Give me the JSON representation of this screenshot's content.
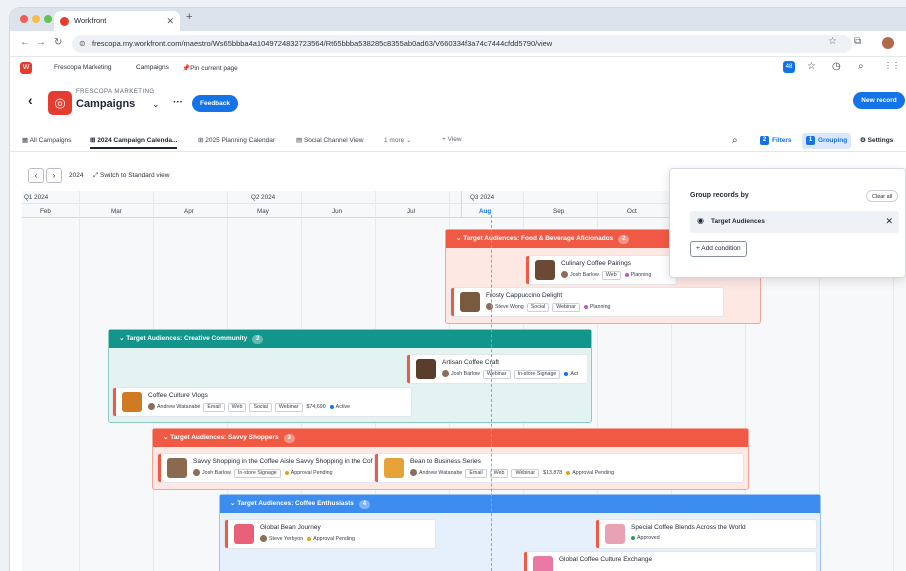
{
  "browser": {
    "tab_title": "Workfront",
    "tab_close": "✕",
    "new_tab": "+",
    "url": "frescopa.my.workfront.com/maestro/Ws65bbba4a1049724832723564/Rt65bbba538285c8355ab0ad63/V660334f3a74c7444cfdd5790/view",
    "nav": {
      "back": "←",
      "fwd": "→",
      "reload": "↻"
    },
    "icons": {
      "star": "☆",
      "ext": "⧉"
    }
  },
  "topnav": {
    "logo": "W",
    "workspace": "Frescopa Marketing",
    "campaigns": "Campaigns",
    "pin_label": "Pin current page",
    "badge": "48",
    "icons": {
      "star": "☆",
      "clock": "◷",
      "search": "⌕",
      "grid": "⋮⋮"
    }
  },
  "page": {
    "back": "‹",
    "org": "FRESCOPA MARKETING",
    "title": "Campaigns",
    "caret": "⌄",
    "more": "···",
    "feedback": "Feedback",
    "new_record": "New record",
    "icon": "◎"
  },
  "views": [
    {
      "label": "All Campaigns",
      "icon": "▦"
    },
    {
      "label": "2024 Campaign Calenda...",
      "icon": "⊞",
      "active": true
    },
    {
      "label": "2025 Planning Calendar",
      "icon": "⊞"
    },
    {
      "label": "Social Channel View",
      "icon": "▤"
    },
    {
      "label": "1 more ⌄"
    },
    {
      "label": "View",
      "icon": "+"
    }
  ],
  "toolbar": {
    "search": "⌕",
    "filters_label": "Filters",
    "filters_count": "2",
    "grouping_label": "Grouping",
    "grouping_count": "1",
    "settings_label": "Settings",
    "settings_icon": "⚙"
  },
  "timeline": {
    "prev": "‹",
    "next": "›",
    "year": "2024",
    "switch": "Switch to Standard view",
    "switch_icon": "⤢",
    "quarters": [
      "Q1 2024",
      "Q2 2024",
      "Q3 2024"
    ],
    "months": [
      "Feb",
      "Mar",
      "Apr",
      "May",
      "Jun",
      "Jul",
      "Aug",
      "Sep",
      "Oct"
    ],
    "groups": [
      {
        "label": "Target Audiences: Food & Beverage Aficionados",
        "count": "2",
        "color": "#f05a44",
        "bg": "#fde8e4",
        "cards": [
          {
            "title": "Culinary Coffee Pairings",
            "owner": "Josh Barlow",
            "tags": [
              "Web"
            ],
            "status": "Planning",
            "status_color": "#c455c8",
            "thumb": "#6b4a35"
          },
          {
            "title": "Frosty Cappuccino Delight",
            "owner": "Steve Wong",
            "tags": [
              "Social",
              "Webinar"
            ],
            "status": "Planning",
            "status_color": "#c455c8",
            "thumb": "#7a5a3e"
          }
        ]
      },
      {
        "label": "Target Audiences: Creative Community",
        "count": "2",
        "color": "#12958a",
        "bg": "#e3f3f1",
        "cards": [
          {
            "title": "Artisan Coffee Craft",
            "owner": "Josh Barlow",
            "tags": [
              "Webinar",
              "In-store Signage"
            ],
            "status": "Act",
            "status_color": "#1473e6",
            "thumb": "#5a3d2b"
          },
          {
            "title": "Coffee Culture Vlogs",
            "owner": "Andrew Watanabe",
            "tags": [
              "Email",
              "Web",
              "Social",
              "Webinar"
            ],
            "budget": "$74,690",
            "status": "Active",
            "status_color": "#1473e6",
            "thumb": "#d07a24"
          }
        ]
      },
      {
        "label": "Target Audiences: Savvy Shoppers",
        "count": "3",
        "color": "#f05a44",
        "bg": "#fde8e4",
        "cards": [
          {
            "title": "Savvy Shopping in the Coffee Aisle Savvy Shopping in the Cof",
            "owner": "Josh Barlow",
            "tags": [
              "In-store Signage"
            ],
            "status": "Approval Pending",
            "status_color": "#e3a21a",
            "thumb": "#8a6a4f"
          },
          {
            "title": "Bean to Business Series",
            "owner": "Andrew Watanabe",
            "tags": [
              "Email",
              "Web",
              "Webinar"
            ],
            "budget": "$13,878",
            "status": "Approval Pending",
            "status_color": "#e3a21a",
            "thumb": "#e8a23a"
          }
        ]
      },
      {
        "label": "Target Audiences: Coffee Enthusiasts",
        "count": "4",
        "color": "#3d8df0",
        "bg": "#e6f0fd",
        "cards": [
          {
            "title": "Global Bean Journey",
            "owner": "Steve Yerbyon",
            "tags": [],
            "status": "Approval Pending",
            "status_color": "#e3a21a",
            "thumb": "#e8607a"
          },
          {
            "title": "Special Coffee Blends Across the World",
            "owner": "",
            "tags": [],
            "status": "Approved",
            "status_color": "#2d9d5c",
            "thumb": "#e7a3b5"
          },
          {
            "title": "Global Coffee Culture Exchange",
            "owner": "",
            "tags": [],
            "status": "",
            "status_color": "#999",
            "thumb": "#e879a4"
          }
        ]
      }
    ]
  },
  "grouping_panel": {
    "title": "Group records by",
    "clear": "Clear all",
    "field": "Target Audiences",
    "remove": "✕",
    "add": "Add condition",
    "add_icon": "+",
    "field_icon": "◉"
  }
}
